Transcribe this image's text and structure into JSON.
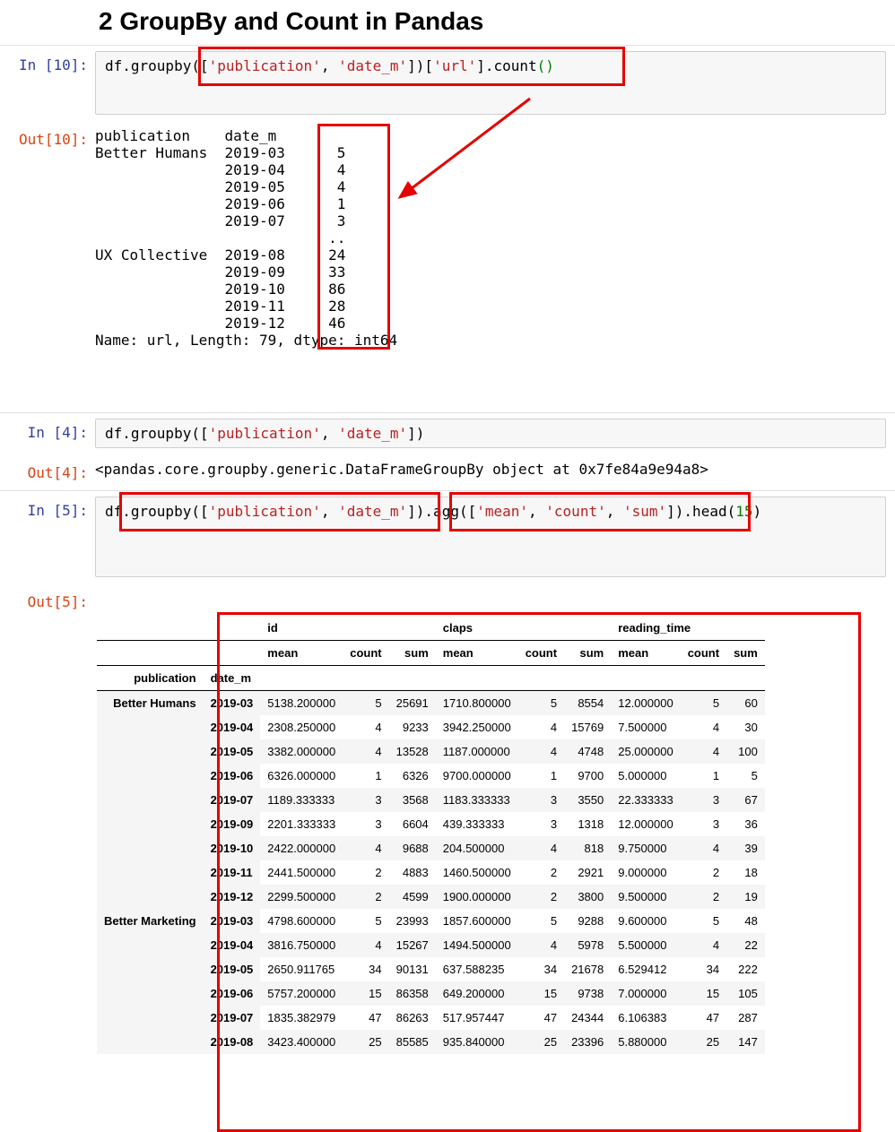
{
  "heading": "2  GroupBy and Count in Pandas",
  "cells": {
    "c10": {
      "in_prompt": "In [10]:",
      "out_prompt": "Out[10]:",
      "code_prefix": "df",
      "code_groupby": ".groupby",
      "code_open": "([",
      "code_str1": "'publication'",
      "code_comma": ", ",
      "code_str2": "'date_m'",
      "code_close1": "])[",
      "code_str3": "'url'",
      "code_close2": "]",
      "code_count": ".count",
      "code_parens": "()",
      "out_header": "publication    date_m",
      "out_rows": [
        "Better Humans  2019-03      5",
        "               2019-04      4",
        "               2019-05      4",
        "               2019-06      1",
        "               2019-07      3",
        "                           ..",
        "UX Collective  2019-08     24",
        "               2019-09     33",
        "               2019-10     86",
        "               2019-11     28",
        "               2019-12     46"
      ],
      "out_footer": "Name: url, Length: 79, dtype: int64"
    },
    "c4": {
      "in_prompt": "In [4]:",
      "out_prompt": "Out[4]:",
      "code_prefix": "df",
      "code_groupby": ".groupby",
      "code_open": "([",
      "code_str1": "'publication'",
      "code_comma": ", ",
      "code_str2": "'date_m'",
      "code_close": "])",
      "out_text": "<pandas.core.groupby.generic.DataFrameGroupBy object at 0x7fe84a9e94a8>"
    },
    "c5": {
      "in_prompt": "In [5]:",
      "out_prompt": "Out[5]:",
      "code_prefix": "df",
      "code_groupby": ".groupby",
      "code_open": "([",
      "code_str1": "'publication'",
      "code_comma": ", ",
      "code_str2": "'date_m'",
      "code_close1": "])",
      "code_agg": ".agg",
      "code_open2": "([",
      "code_agg1": "'mean'",
      "code_agg2": "'count'",
      "code_agg3": "'sum'",
      "code_close2": "])",
      "code_head": ".head",
      "code_head_open": "(",
      "code_head_num": "15",
      "code_head_close": ")"
    }
  },
  "table": {
    "index_label_1": "publication",
    "index_label_2": "date_m",
    "toplevel": [
      "id",
      "claps",
      "reading_time"
    ],
    "sublevel": [
      "mean",
      "count",
      "sum"
    ],
    "groups": [
      {
        "name": "Better Humans",
        "rows": [
          {
            "date": "2019-03",
            "id_mean": "5138.200000",
            "id_count": "5",
            "id_sum": "25691",
            "cl_mean": "1710.800000",
            "cl_count": "5",
            "cl_sum": "8554",
            "rt_mean": "12.000000",
            "rt_count": "5",
            "rt_sum": "60"
          },
          {
            "date": "2019-04",
            "id_mean": "2308.250000",
            "id_count": "4",
            "id_sum": "9233",
            "cl_mean": "3942.250000",
            "cl_count": "4",
            "cl_sum": "15769",
            "rt_mean": "7.500000",
            "rt_count": "4",
            "rt_sum": "30"
          },
          {
            "date": "2019-05",
            "id_mean": "3382.000000",
            "id_count": "4",
            "id_sum": "13528",
            "cl_mean": "1187.000000",
            "cl_count": "4",
            "cl_sum": "4748",
            "rt_mean": "25.000000",
            "rt_count": "4",
            "rt_sum": "100"
          },
          {
            "date": "2019-06",
            "id_mean": "6326.000000",
            "id_count": "1",
            "id_sum": "6326",
            "cl_mean": "9700.000000",
            "cl_count": "1",
            "cl_sum": "9700",
            "rt_mean": "5.000000",
            "rt_count": "1",
            "rt_sum": "5"
          },
          {
            "date": "2019-07",
            "id_mean": "1189.333333",
            "id_count": "3",
            "id_sum": "3568",
            "cl_mean": "1183.333333",
            "cl_count": "3",
            "cl_sum": "3550",
            "rt_mean": "22.333333",
            "rt_count": "3",
            "rt_sum": "67"
          },
          {
            "date": "2019-09",
            "id_mean": "2201.333333",
            "id_count": "3",
            "id_sum": "6604",
            "cl_mean": "439.333333",
            "cl_count": "3",
            "cl_sum": "1318",
            "rt_mean": "12.000000",
            "rt_count": "3",
            "rt_sum": "36"
          },
          {
            "date": "2019-10",
            "id_mean": "2422.000000",
            "id_count": "4",
            "id_sum": "9688",
            "cl_mean": "204.500000",
            "cl_count": "4",
            "cl_sum": "818",
            "rt_mean": "9.750000",
            "rt_count": "4",
            "rt_sum": "39"
          },
          {
            "date": "2019-11",
            "id_mean": "2441.500000",
            "id_count": "2",
            "id_sum": "4883",
            "cl_mean": "1460.500000",
            "cl_count": "2",
            "cl_sum": "2921",
            "rt_mean": "9.000000",
            "rt_count": "2",
            "rt_sum": "18"
          },
          {
            "date": "2019-12",
            "id_mean": "2299.500000",
            "id_count": "2",
            "id_sum": "4599",
            "cl_mean": "1900.000000",
            "cl_count": "2",
            "cl_sum": "3800",
            "rt_mean": "9.500000",
            "rt_count": "2",
            "rt_sum": "19"
          }
        ]
      },
      {
        "name": "Better Marketing",
        "rows": [
          {
            "date": "2019-03",
            "id_mean": "4798.600000",
            "id_count": "5",
            "id_sum": "23993",
            "cl_mean": "1857.600000",
            "cl_count": "5",
            "cl_sum": "9288",
            "rt_mean": "9.600000",
            "rt_count": "5",
            "rt_sum": "48"
          },
          {
            "date": "2019-04",
            "id_mean": "3816.750000",
            "id_count": "4",
            "id_sum": "15267",
            "cl_mean": "1494.500000",
            "cl_count": "4",
            "cl_sum": "5978",
            "rt_mean": "5.500000",
            "rt_count": "4",
            "rt_sum": "22"
          },
          {
            "date": "2019-05",
            "id_mean": "2650.911765",
            "id_count": "34",
            "id_sum": "90131",
            "cl_mean": "637.588235",
            "cl_count": "34",
            "cl_sum": "21678",
            "rt_mean": "6.529412",
            "rt_count": "34",
            "rt_sum": "222"
          },
          {
            "date": "2019-06",
            "id_mean": "5757.200000",
            "id_count": "15",
            "id_sum": "86358",
            "cl_mean": "649.200000",
            "cl_count": "15",
            "cl_sum": "9738",
            "rt_mean": "7.000000",
            "rt_count": "15",
            "rt_sum": "105"
          },
          {
            "date": "2019-07",
            "id_mean": "1835.382979",
            "id_count": "47",
            "id_sum": "86263",
            "cl_mean": "517.957447",
            "cl_count": "47",
            "cl_sum": "24344",
            "rt_mean": "6.106383",
            "rt_count": "47",
            "rt_sum": "287"
          },
          {
            "date": "2019-08",
            "id_mean": "3423.400000",
            "id_count": "25",
            "id_sum": "85585",
            "cl_mean": "935.840000",
            "cl_count": "25",
            "cl_sum": "23396",
            "rt_mean": "5.880000",
            "rt_count": "25",
            "rt_sum": "147"
          }
        ]
      }
    ]
  }
}
